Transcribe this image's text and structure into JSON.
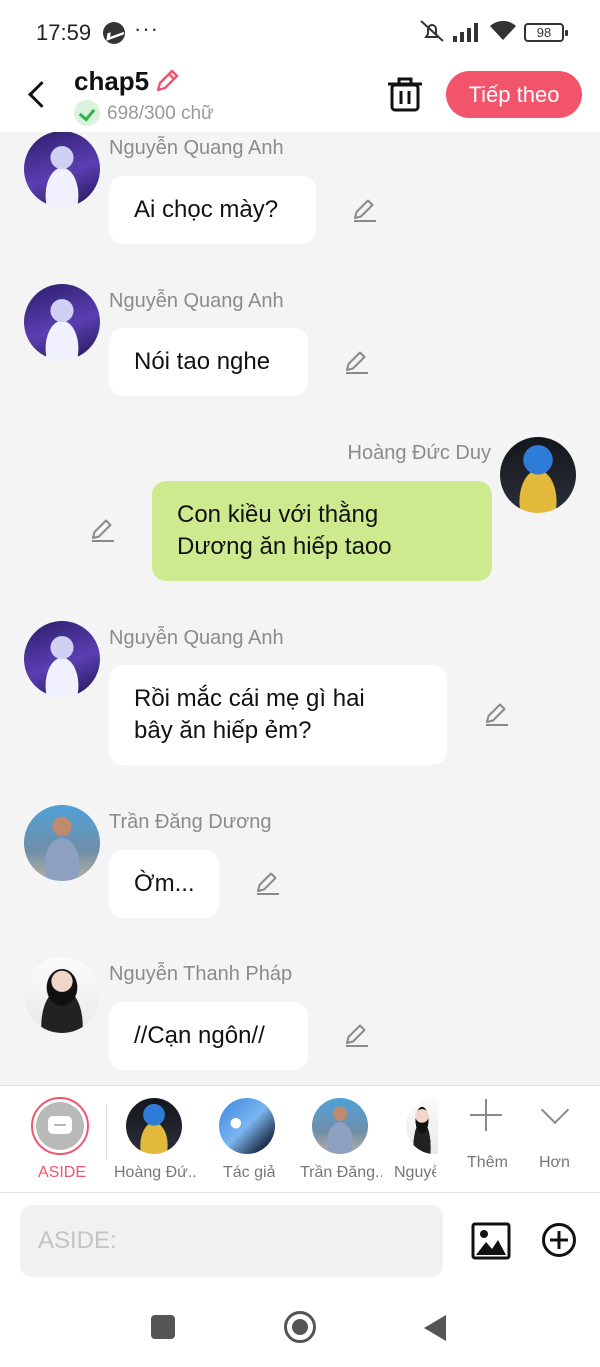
{
  "status_bar": {
    "time": "17:59",
    "dots": "···",
    "battery": "98",
    "icons": [
      "messenger-icon",
      "mute-icon",
      "signal-icon",
      "wifi-icon",
      "battery-icon"
    ]
  },
  "header": {
    "title": "chap5",
    "word_count": "698/300 chữ",
    "next_label": "Tiếp theo",
    "accent_color": "#f2546c"
  },
  "messages": [
    {
      "sender": "Nguyễn Quang Anh",
      "text": "Ai chọc mày?",
      "side": "left",
      "avatar": "nguyen-quang-anh-avatar"
    },
    {
      "sender": "Nguyễn Quang Anh",
      "text": "Nói tao nghe",
      "side": "left",
      "avatar": "nguyen-quang-anh-avatar"
    },
    {
      "sender": "Hoàng Đức Duy",
      "text": "Con kiều với thằng\nDương ăn hiếp taoo",
      "side": "right",
      "avatar": "hoang-duc-duy-avatar"
    },
    {
      "sender": "Nguyễn Quang Anh",
      "text": "Rồi mắc cái mẹ gì hai\nbây ăn hiếp ẻm?",
      "side": "left",
      "avatar": "nguyen-quang-anh-avatar"
    },
    {
      "sender": "Trần Đăng Dương",
      "text": "Ờm...",
      "side": "left",
      "avatar": "tran-dang-duong-avatar"
    },
    {
      "sender": "Nguyễn Thanh Pháp",
      "text": "//Cạn ngôn//",
      "side": "left",
      "avatar": "nguyen-thanh-phap-avatar"
    }
  ],
  "characters": [
    {
      "label": "ASIDE",
      "selected": true
    },
    {
      "label": "Hoàng Đứ..."
    },
    {
      "label": "Tác giả"
    },
    {
      "label": "Trần Đăng..."
    },
    {
      "label": "Nguyễ"
    }
  ],
  "char_actions": {
    "add_label": "Thêm",
    "more_label": "Hơn"
  },
  "input": {
    "placeholder": "ASIDE:"
  },
  "colors": {
    "bubble_mine": "#cdeb8e",
    "bubble_other": "#ffffff",
    "background": "#f4f4f4"
  }
}
